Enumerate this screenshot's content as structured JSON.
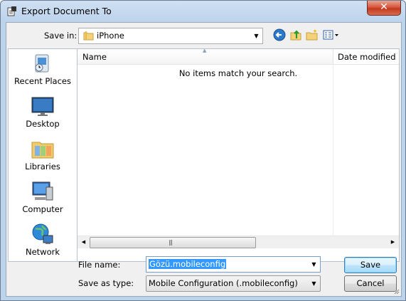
{
  "window": {
    "title": "Export Document To",
    "close_glyph": "✕"
  },
  "toolbar": {
    "save_in_label": "Save in:",
    "save_in_value": "iPhone",
    "icons": [
      "back-icon",
      "up-folder-icon",
      "new-folder-icon",
      "view-menu-icon"
    ]
  },
  "places": [
    {
      "label": "Recent Places",
      "icon": "recent-places-icon"
    },
    {
      "label": "Desktop",
      "icon": "desktop-icon"
    },
    {
      "label": "Libraries",
      "icon": "libraries-icon"
    },
    {
      "label": "Computer",
      "icon": "computer-icon"
    },
    {
      "label": "Network",
      "icon": "network-icon"
    }
  ],
  "filelist": {
    "columns": [
      "Name",
      "Date modified"
    ],
    "empty_message": "No items match your search."
  },
  "form": {
    "file_name_label": "File name:",
    "file_name_value": "Gözü.mobileconfig",
    "save_type_label": "Save as type:",
    "save_type_value": "Mobile Configuration (.mobileconfig)"
  },
  "buttons": {
    "save": "Save",
    "cancel": "Cancel"
  },
  "colors": {
    "title_gradient": "#bcd3ec",
    "selection": "#3399ff",
    "close_button": "#c23a1f"
  }
}
